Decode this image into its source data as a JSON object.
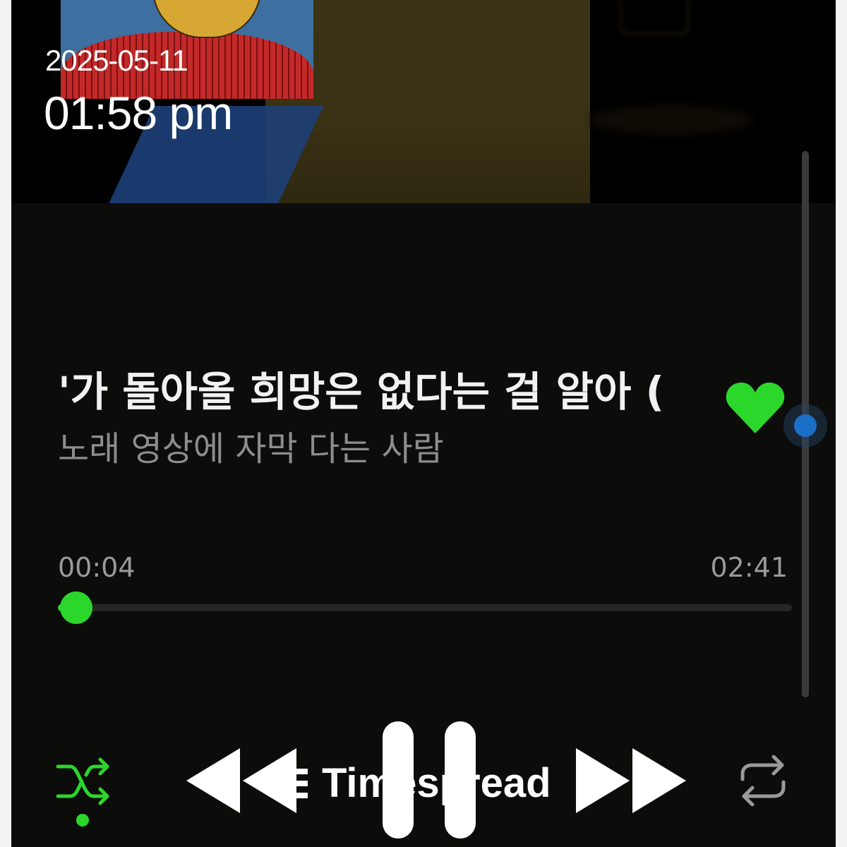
{
  "timestamp": {
    "date": "2025-05-11",
    "time": "01:58 pm"
  },
  "track": {
    "title": "'가 돌아올 희망은 없다는 걸 알아 (",
    "artist": "노래 영상에 자막 다는 사람",
    "liked": true
  },
  "progress": {
    "current": "00:04",
    "total": "02:41",
    "fraction": 0.025
  },
  "controls": {
    "shuffle_active": true,
    "icons": [
      "shuffle-icon",
      "previous-icon",
      "pause-icon",
      "next-icon",
      "repeat-icon"
    ]
  },
  "watermark": {
    "text": "Timespread"
  },
  "colors": {
    "accent": "#2bd72b",
    "background": "#0c0c0b",
    "scroll_knob": "#1a6fc8",
    "secondary_text": "#8d8d8d"
  }
}
